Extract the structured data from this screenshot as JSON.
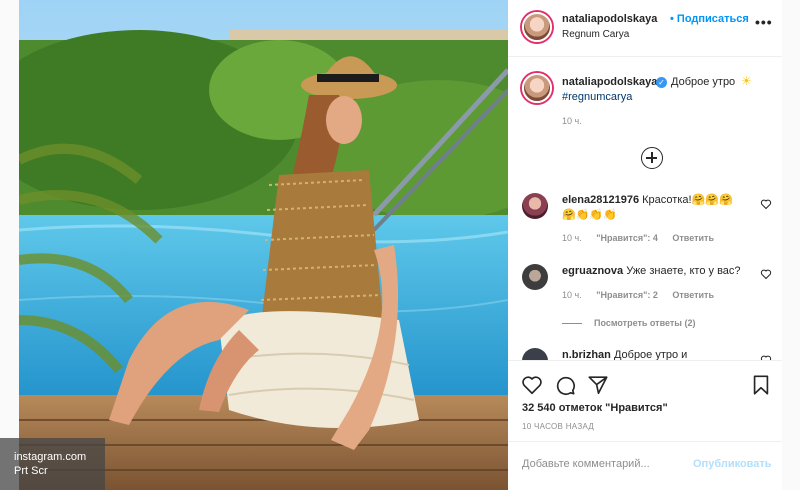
{
  "watermark": {
    "line1": "instagram.com",
    "line2": "Prt Scr"
  },
  "header": {
    "username": "nataliapodolskaya",
    "follow_label": "• Подписаться",
    "location": "Regnum Carya",
    "more_icon": "more-horizontal-icon"
  },
  "caption": {
    "username": "nataliapodolskaya",
    "verified_mark": "✓",
    "text": "Доброе утро",
    "emoji": "☀",
    "hashtag": "#regnumcarya",
    "time": "10 ч."
  },
  "comments": [
    {
      "username": "elena28121976",
      "text_line1": "Красотка!🤗🤗🤗",
      "text_line2": "🤗👏👏👏",
      "time": "10 ч.",
      "likes": "\"Нравится\": 4",
      "reply": "Ответить"
    },
    {
      "username": "egruaznova",
      "text": "Уже знаете, кто у вас?",
      "time": "10 ч.",
      "likes": "\"Нравится\": 2",
      "reply": "Ответить"
    },
    {
      "username": "n.brizhan",
      "text": "Доброе утро и"
    }
  ],
  "view_replies": "Посмотреть ответы (2)",
  "likes": "32 540 отметок \"Нравится\"",
  "time_ago": "10 ЧАСОВ НАЗАД",
  "add_comment": {
    "placeholder": "Добавьте комментарий...",
    "post_label": "Опубликовать"
  },
  "colors": {
    "link": "#0095f6",
    "hashtag": "#00376b",
    "muted": "#8e8e8e",
    "post_disabled": "#b2dffc"
  }
}
